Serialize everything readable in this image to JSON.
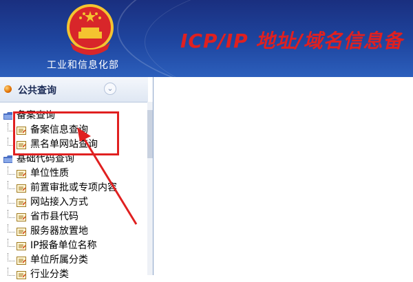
{
  "header": {
    "org_name": "工业和信息化部",
    "banner_title": "ICP/IP 地址/域名信息备"
  },
  "sidebar": {
    "panel_title": "公共查询",
    "groups": [
      {
        "label": "备案查询",
        "items": [
          "备案信息查询",
          "黑名单网站查询"
        ]
      },
      {
        "label": "基础代码查询",
        "items": [
          "单位性质",
          "前置审批或专项内容",
          "网站接入方式",
          "省市县代码",
          "服务器放置地",
          "IP报备单位名称",
          "单位所属分类",
          "行业分类"
        ]
      }
    ]
  },
  "colors": {
    "header_bg": "#1f46a0",
    "title_red": "#e02020",
    "annotation_red": "#e02020"
  },
  "icons": {
    "emblem": "national-emblem-icon",
    "folder": "folder-icon",
    "leaf": "document-icon",
    "bullet": "orange-dot-icon",
    "collapse": "chevron-down-icon"
  }
}
